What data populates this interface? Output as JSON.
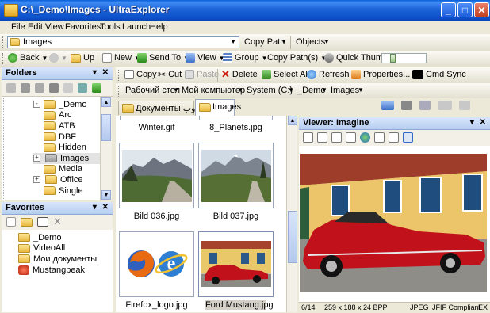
{
  "window": {
    "title": "C:\\_Demo\\Images - UltraExplorer",
    "minimize": "_",
    "maximize": "□",
    "close": "✕"
  },
  "menu": [
    "File",
    "Edit",
    "View",
    "Favorites",
    "Tools",
    "Launch",
    "Help"
  ],
  "address": {
    "value": "Images",
    "copy_path": "Copy Path",
    "objects": "Objects"
  },
  "toolbar": {
    "back": "Back",
    "up": "Up",
    "new": "New",
    "send_to": "Send To",
    "view": "View",
    "group": "Group",
    "copy_paths": "Copy Path(s)",
    "quick_thumbs": "Quick Thumbs"
  },
  "actions": {
    "copy": "Copy",
    "cut": "Cut",
    "paste": "Paste",
    "delete": "Delete",
    "select_all": "Select All",
    "refresh": "Refresh",
    "properties": "Properties...",
    "cmd_sync": "Cmd Sync"
  },
  "breadcrumb": [
    "Рабочий стол",
    "Мой компьютер",
    "System (C:)",
    "_Demo",
    "Images"
  ],
  "tabs": [
    {
      "label": "Документы ندوب"
    },
    {
      "label": "Images"
    }
  ],
  "folders": {
    "title": "Folders",
    "items": [
      {
        "label": "_Demo",
        "expander": "-"
      },
      {
        "label": "Arc"
      },
      {
        "label": "ATB"
      },
      {
        "label": "DBF"
      },
      {
        "label": "Hidden"
      },
      {
        "label": "Images",
        "expander": "+"
      },
      {
        "label": "Media"
      },
      {
        "label": "Office",
        "expander": "+"
      },
      {
        "label": "Single"
      }
    ]
  },
  "favorites": {
    "title": "Favorites",
    "items": [
      {
        "label": "_Demo"
      },
      {
        "label": "VideoAll"
      },
      {
        "label": "Мои документы"
      },
      {
        "label": "Mustangpeak"
      }
    ]
  },
  "files": {
    "top_row": [
      "Winter.gif",
      "8_Planets.jpg"
    ],
    "items": [
      {
        "name": "Bild 036.jpg"
      },
      {
        "name": "Bild 037.jpg"
      },
      {
        "name": "Firefox_logo.jpg"
      },
      {
        "name": "Ford Mustang.jpg"
      }
    ],
    "scroll_position": 0.65
  },
  "viewer": {
    "title": "Viewer: Imagine",
    "status": [
      "6/14",
      "259 x 188 x 24 BPP",
      "JPEG",
      "JFIF Compliant",
      "EX"
    ]
  },
  "colors": {
    "accent": "#0a5fd8",
    "panel_header": "#c3d5f4",
    "car_red": "#c1121b"
  }
}
